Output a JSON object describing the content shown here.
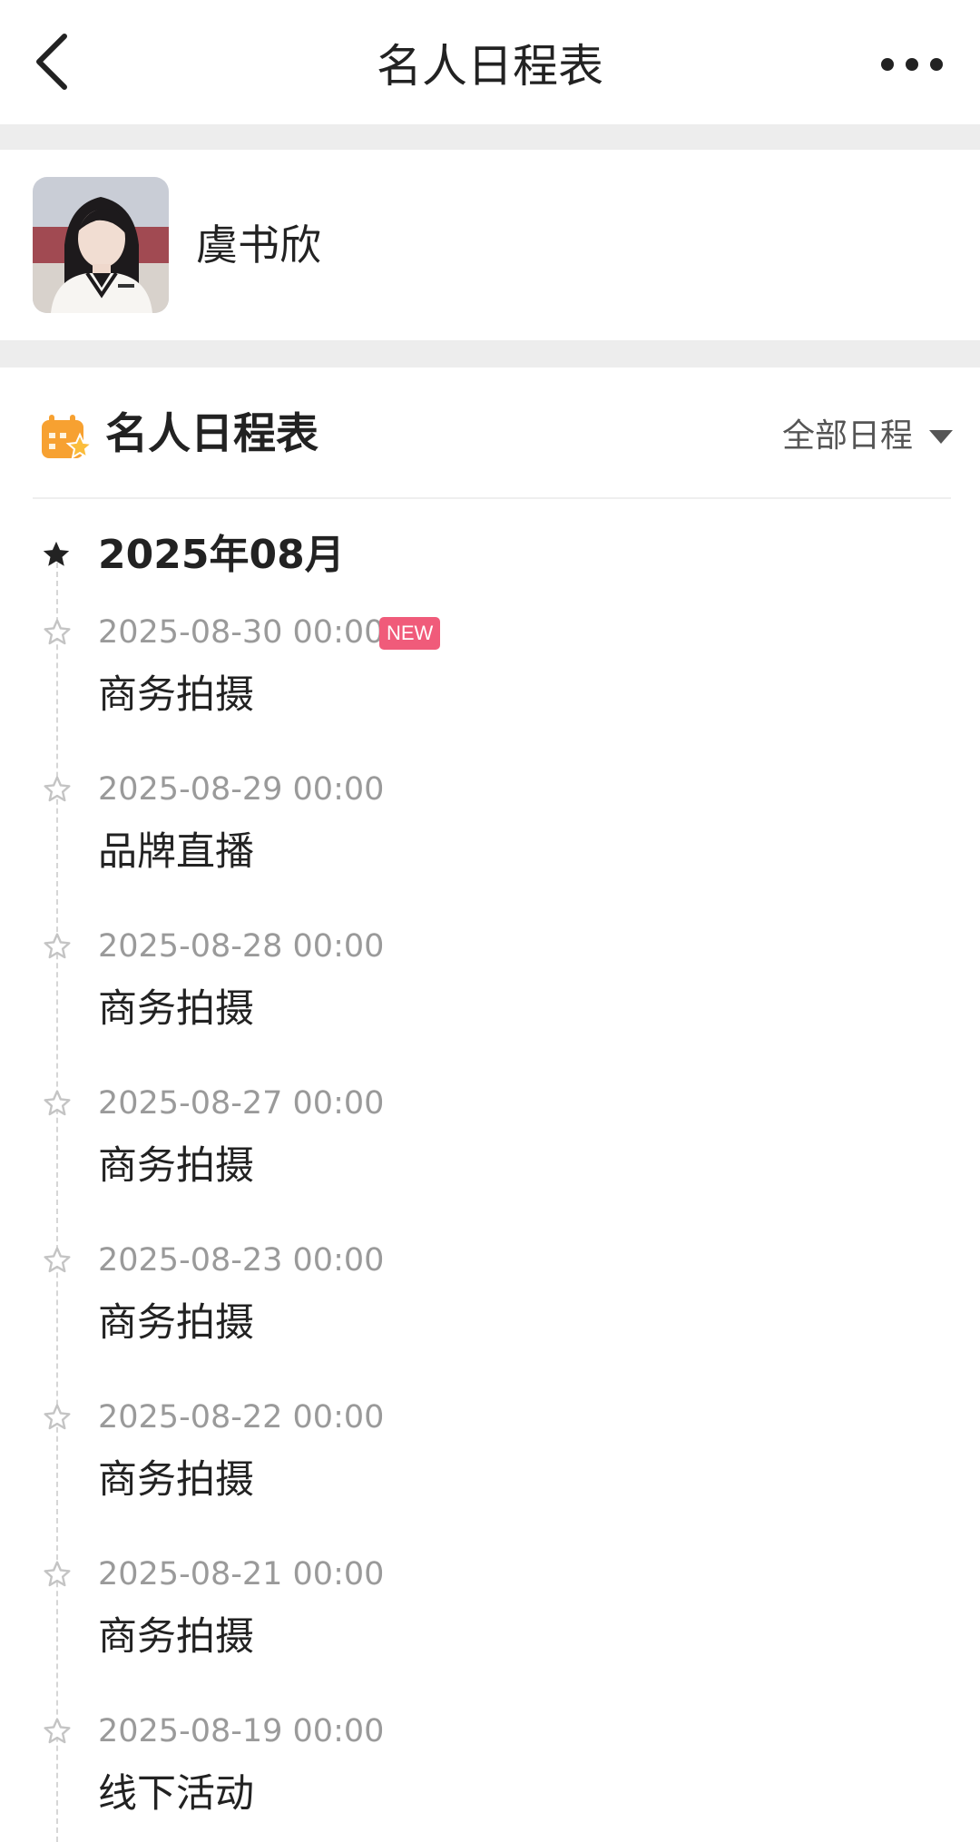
{
  "navbar": {
    "title": "名人日程表"
  },
  "profile": {
    "name": "虞书欣"
  },
  "schedule": {
    "title": "名人日程表",
    "filter_label": "全部日程",
    "month": "2025年08月",
    "new_badge": "NEW",
    "events": [
      {
        "time": "2025-08-30 00:00",
        "title": "商务拍摄",
        "is_new": true
      },
      {
        "time": "2025-08-29 00:00",
        "title": "品牌直播"
      },
      {
        "time": "2025-08-28 00:00",
        "title": "商务拍摄"
      },
      {
        "time": "2025-08-27 00:00",
        "title": "商务拍摄"
      },
      {
        "time": "2025-08-23 00:00",
        "title": "商务拍摄"
      },
      {
        "time": "2025-08-22 00:00",
        "title": "商务拍摄"
      },
      {
        "time": "2025-08-21 00:00",
        "title": "商务拍摄"
      },
      {
        "time": "2025-08-19 00:00",
        "title": "线下活动"
      }
    ]
  },
  "icons": {
    "back": "chevron-left-icon",
    "more": "more-dots-icon",
    "schedule": "calendar-star-icon",
    "month_marker": "star-filled-icon",
    "event_marker": "star-outline-icon",
    "filter": "caret-down-icon"
  },
  "colors": {
    "new_badge": "#f05b7a",
    "schedule_icon": "#f7a131",
    "muted_text": "#9a9a9a",
    "separator": "#ededed"
  }
}
